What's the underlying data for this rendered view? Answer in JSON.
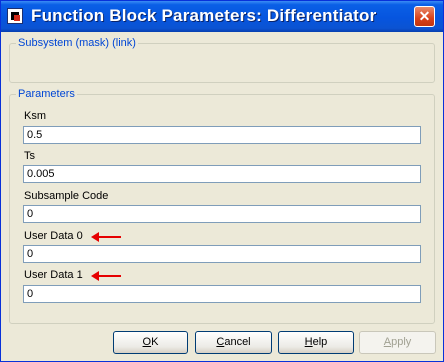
{
  "window": {
    "title": "Function Block Parameters: Differentiator",
    "close_glyph": "✕"
  },
  "subsystem_group": {
    "legend": "Subsystem (mask) (link)"
  },
  "parameters_group": {
    "legend": "Parameters",
    "fields": [
      {
        "label": "Ksm",
        "value": "0.5"
      },
      {
        "label": "Ts",
        "value": "0.005"
      },
      {
        "label": "Subsample Code",
        "value": "0"
      },
      {
        "label": "User Data 0",
        "value": "0"
      },
      {
        "label": "User Data 1",
        "value": "0"
      }
    ]
  },
  "annotations": {
    "arrow_color": "#e60000",
    "arrow_icon": "red-arrow-left-icon"
  },
  "buttons": {
    "ok": {
      "mnemonic": "O",
      "rest": "K"
    },
    "cancel": {
      "mnemonic": "C",
      "rest": "ancel"
    },
    "help": {
      "mnemonic": "H",
      "rest": "elp"
    },
    "apply": {
      "mnemonic": "A",
      "rest": "pply",
      "enabled": false
    }
  },
  "colors": {
    "titlebar": "#0655df",
    "window_bg": "#ece9d8",
    "legend_text": "#0046d5"
  }
}
